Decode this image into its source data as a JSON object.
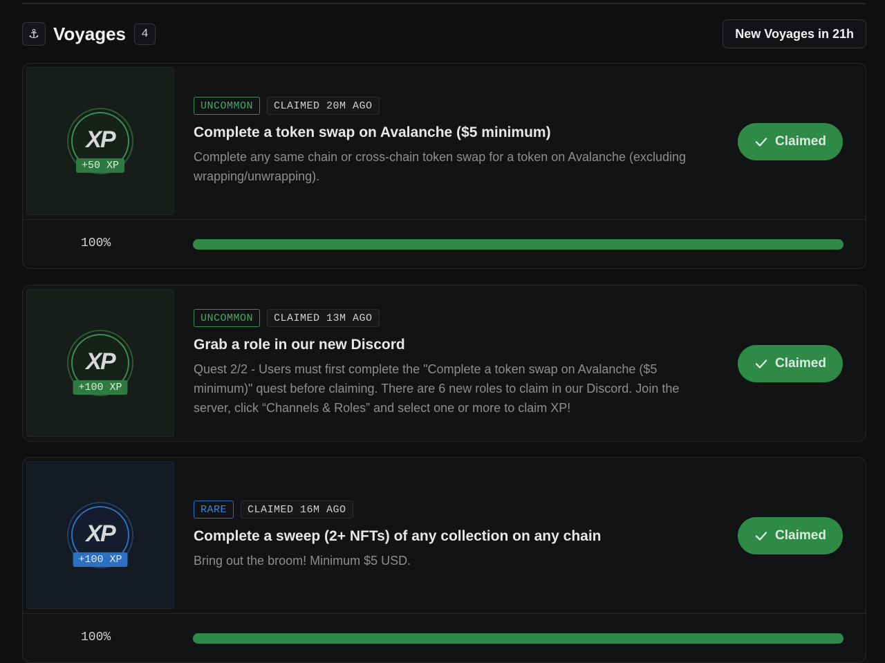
{
  "header": {
    "anchor_icon": "anchor-icon",
    "title": "Voyages",
    "count": "4",
    "new_voyages_label": "New Voyages in 21h"
  },
  "colors": {
    "uncommon": "#3a8e4f",
    "rare": "#2f6fc0",
    "claimed_button": "#2f8a48",
    "progress_fill": "#2f8a48"
  },
  "voyages": [
    {
      "logo_text": "XP",
      "xp": "+50 XP",
      "rarity": "UNCOMMON",
      "status": "CLAIMED 20M AGO",
      "title": "Complete a token swap on Avalanche ($5 minimum)",
      "description": "Complete any same chain or cross-chain token swap for a token on Avalanche (excluding wrapping/unwrapping).",
      "button_label": "Claimed",
      "progress_label": "100%",
      "progress": 1.0
    },
    {
      "logo_text": "XP",
      "xp": "+100 XP",
      "rarity": "UNCOMMON",
      "status": "CLAIMED 13M AGO",
      "title": "Grab a role in our new Discord",
      "description": "Quest 2/2 - Users must first complete the \"Complete a token swap on Avalanche ($5 minimum)\" quest before claiming. There are 6 new roles to claim in our Discord. Join the server, click “Channels & Roles” and select one or more to claim XP!",
      "button_label": "Claimed"
    },
    {
      "logo_text": "XP",
      "xp": "+100 XP",
      "rarity": "RARE",
      "status": "CLAIMED 16M AGO",
      "title": "Complete a sweep (2+ NFTs) of any collection on any chain",
      "description": "Bring out the broom! Minimum $5 USD.",
      "button_label": "Claimed",
      "progress_label": "100%",
      "progress": 1.0
    }
  ]
}
